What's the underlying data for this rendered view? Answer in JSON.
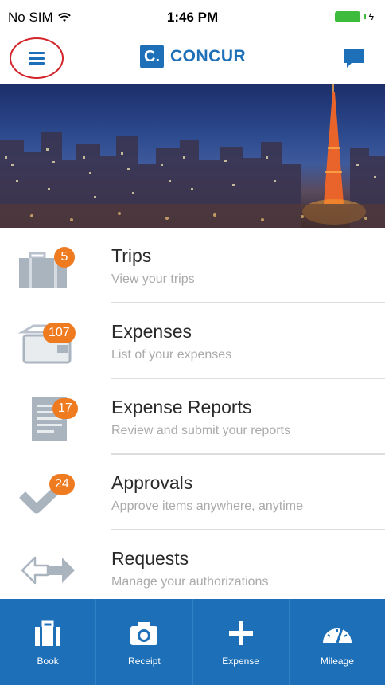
{
  "status_bar": {
    "carrier": "No SIM",
    "time": "1:46 PM"
  },
  "header": {
    "brand_mark": "C.",
    "brand_name": "CONCUR"
  },
  "colors": {
    "brand_blue": "#1d70b8",
    "badge_orange": "#ef7b21",
    "menu_highlight_red": "#d2242a"
  },
  "list": {
    "items": [
      {
        "title": "Trips",
        "subtitle": "View your trips",
        "badge": "5",
        "icon": "suitcase-icon"
      },
      {
        "title": "Expenses",
        "subtitle": "List of your expenses",
        "badge": "107",
        "icon": "wallet-icon"
      },
      {
        "title": "Expense Reports",
        "subtitle": "Review and submit your reports",
        "badge": "17",
        "icon": "report-icon"
      },
      {
        "title": "Approvals",
        "subtitle": "Approve items anywhere, anytime",
        "badge": "24",
        "icon": "checkmark-icon"
      },
      {
        "title": "Requests",
        "subtitle": "Manage your authorizations",
        "badge": "",
        "icon": "arrows-icon"
      }
    ]
  },
  "tabbar": {
    "tabs": [
      {
        "label": "Book",
        "icon": "briefcase-icon"
      },
      {
        "label": "Receipt",
        "icon": "camera-icon"
      },
      {
        "label": "Expense",
        "icon": "plus-icon"
      },
      {
        "label": "Mileage",
        "icon": "speedometer-icon"
      }
    ]
  }
}
